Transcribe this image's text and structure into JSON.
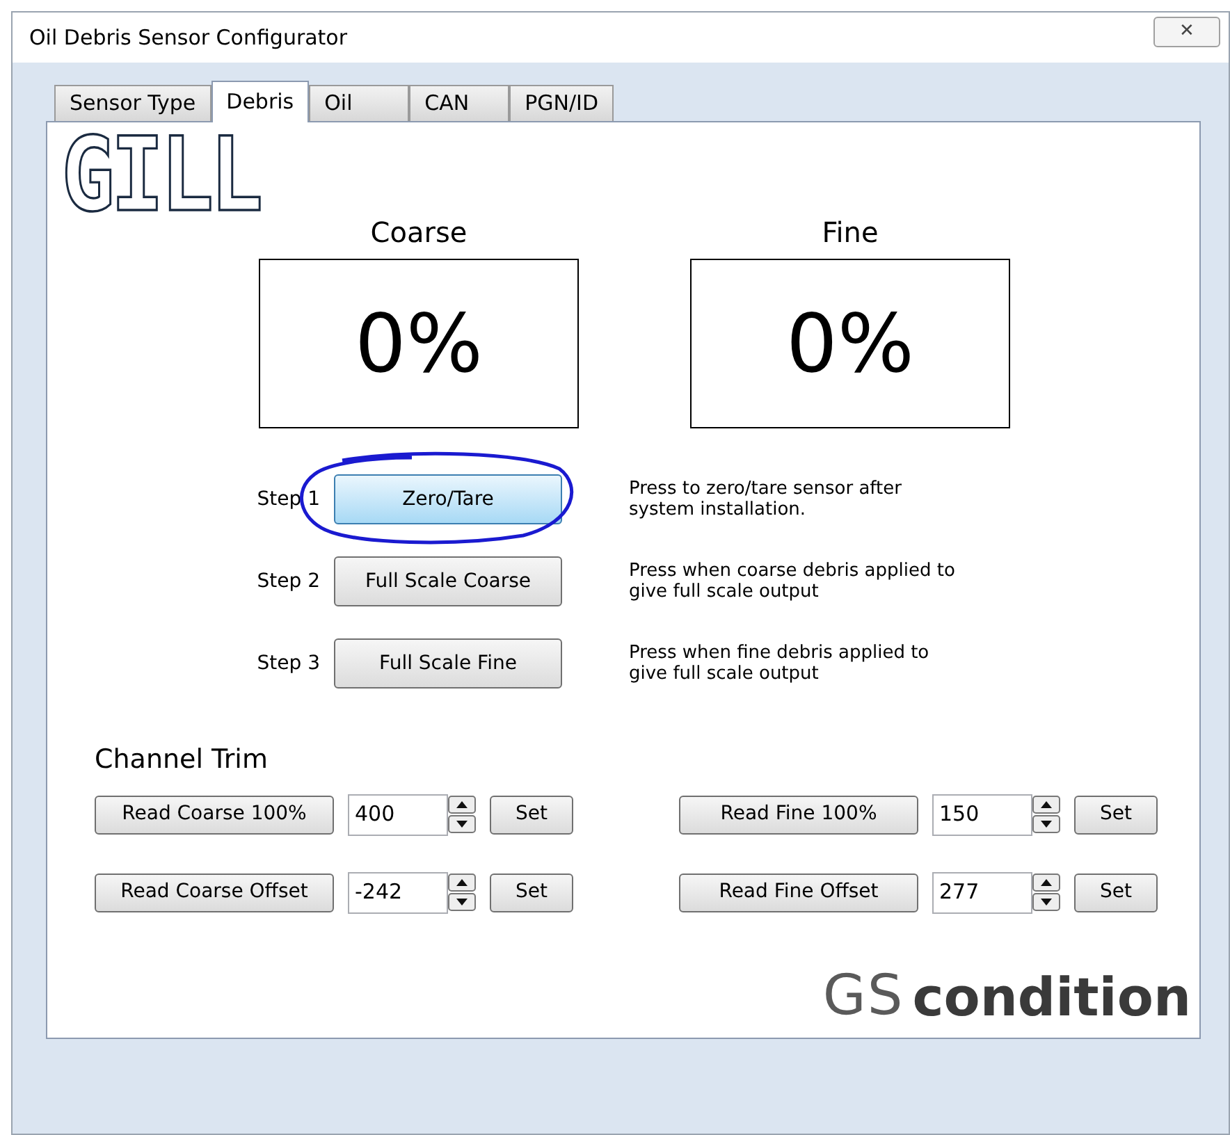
{
  "window": {
    "title": "Oil Debris Sensor Configurator",
    "close": "✕"
  },
  "tabs": [
    {
      "label": "Sensor Type",
      "selected": false
    },
    {
      "label": "Debris",
      "selected": true
    },
    {
      "label": "Oil",
      "selected": false
    },
    {
      "label": "CAN",
      "selected": false
    },
    {
      "label": "PGN/ID",
      "selected": false
    }
  ],
  "logo_top": "GILL",
  "readouts": [
    {
      "label": "Coarse",
      "value": "0%"
    },
    {
      "label": "Fine",
      "value": "0%"
    }
  ],
  "steps": [
    {
      "label": "Step 1",
      "button": "Zero/Tare",
      "highlighted": true,
      "circled": true,
      "note": "Press to zero/tare sensor after system installation."
    },
    {
      "label": "Step 2",
      "button": "Full Scale Coarse",
      "highlighted": false,
      "circled": false,
      "note": "Press when coarse debris applied to give full scale output"
    },
    {
      "label": "Step 3",
      "button": "Full Scale Fine",
      "highlighted": false,
      "circled": false,
      "note": "Press when fine debris applied to give full scale output"
    }
  ],
  "channel_trim": {
    "title": "Channel Trim",
    "rows": [
      {
        "read": "Read Coarse 100%",
        "value": "400",
        "set": "Set"
      },
      {
        "read": "Read Fine 100%",
        "value": "150",
        "set": "Set"
      },
      {
        "read": "Read Coarse Offset",
        "value": "-242",
        "set": "Set"
      },
      {
        "read": "Read Fine Offset",
        "value": "277",
        "set": "Set"
      }
    ]
  },
  "logo_bottom": {
    "part_1": "GS",
    "part_2": "condition"
  }
}
